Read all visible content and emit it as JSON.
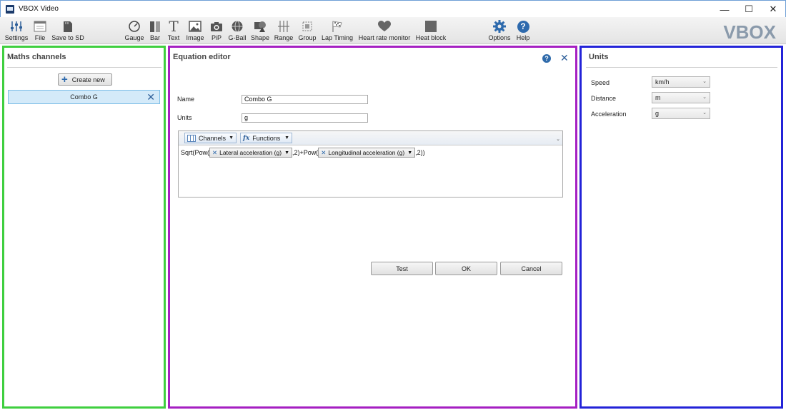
{
  "window": {
    "title": "VBOX Video"
  },
  "toolbar": {
    "items": [
      {
        "label": "Settings",
        "icon": "sliders-icon"
      },
      {
        "label": "File",
        "icon": "file-icon"
      },
      {
        "label": "Save to SD",
        "icon": "sd-card-icon"
      },
      {
        "label": "Gauge",
        "icon": "gauge-icon"
      },
      {
        "label": "Bar",
        "icon": "bar-icon"
      },
      {
        "label": "Text",
        "icon": "text-icon"
      },
      {
        "label": "Image",
        "icon": "image-icon"
      },
      {
        "label": "PiP",
        "icon": "camera-icon"
      },
      {
        "label": "G-Ball",
        "icon": "globe-icon"
      },
      {
        "label": "Shape",
        "icon": "shape-icon"
      },
      {
        "label": "Range",
        "icon": "range-icon"
      },
      {
        "label": "Group",
        "icon": "group-icon"
      },
      {
        "label": "Lap Timing",
        "icon": "checkered-flag-icon"
      },
      {
        "label": "Heart rate monitor",
        "icon": "heart-icon"
      },
      {
        "label": "Heat block",
        "icon": "heat-block-icon"
      },
      {
        "label": "Options",
        "icon": "gear-icon"
      },
      {
        "label": "Help",
        "icon": "help-icon"
      }
    ],
    "logo": "VBOX"
  },
  "maths_channels": {
    "title": "Maths channels",
    "create_label": "Create new",
    "items": [
      {
        "label": "Combo G"
      }
    ]
  },
  "equation_editor": {
    "title": "Equation editor",
    "name_label": "Name",
    "name_value": "Combo G",
    "units_label": "Units",
    "units_value": "g",
    "channels_label": "Channels",
    "functions_label": "Functions",
    "formula": {
      "part1": "Sqrt(Pow(",
      "chip1": "Lateral acceleration (g)",
      "part2": ",2)+Pow(",
      "chip2": "Longitudinal acceleration (g)",
      "part3": ",2))"
    },
    "test_label": "Test",
    "ok_label": "OK",
    "cancel_label": "Cancel"
  },
  "units": {
    "title": "Units",
    "rows": [
      {
        "label": "Speed",
        "value": "km/h"
      },
      {
        "label": "Distance",
        "value": "m"
      },
      {
        "label": "Acceleration",
        "value": "g"
      }
    ]
  }
}
